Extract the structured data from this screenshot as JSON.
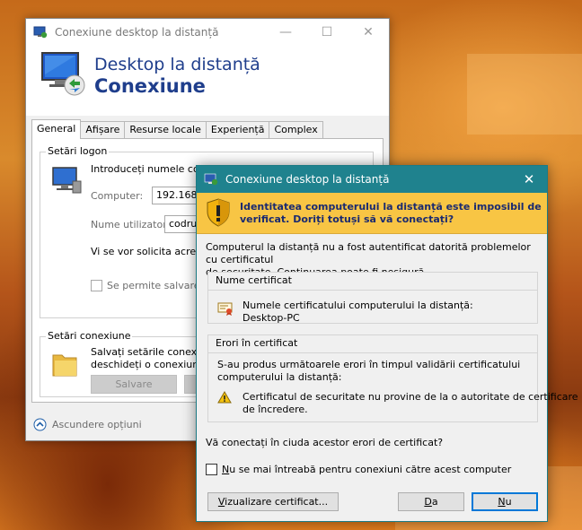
{
  "main_window": {
    "title": "Conexiune desktop la distanță",
    "header_line1": "Desktop la distanță",
    "header_line2": "Conexiune",
    "tabs": [
      {
        "label": "General"
      },
      {
        "label": "Afișare"
      },
      {
        "label": "Resurse locale"
      },
      {
        "label": "Experiență"
      },
      {
        "label": "Complex"
      }
    ],
    "logon": {
      "group_label": "Setări logon",
      "intro": "Introduceți numele computerului la distanță.",
      "computer_label": "Computer:",
      "computer_value": "192.168.",
      "user_label": "Nume utilizator:",
      "user_value": "codru",
      "credentials_note": "Vi se vor solicita acreditările la conectare.",
      "save_checkbox_label": "Se permite salvarea acreditărilor"
    },
    "connection": {
      "group_label": "Setări conexiune",
      "line1": "Salvați setările conexiunii curente într-un",
      "line2": "deschideți o conexiune salvată.",
      "save_button": "Salvare"
    },
    "hide_options": "Ascundere opțiuni"
  },
  "security_dialog": {
    "title": "Conexiune desktop la distanță",
    "warning_title_line1": "Identitatea computerului la distanță este imposibil de",
    "warning_title_line2": "verificat. Doriți totuși să vă conectați?",
    "description_line1": "Computerul la distanță nu a fost autentificat datorită problemelor cu certificatul",
    "description_line2": "de securitate. Continuarea poate fi nesigură.",
    "certificate_group_label": "Nume certificat",
    "certificate_name_label": "Numele certificatului computerului la distanță:",
    "certificate_name_value": "Desktop-PC",
    "errors_group_label": "Erori în certificat",
    "errors_intro_line1": "S-au produs următoarele erori în timpul validării certificatului",
    "errors_intro_line2": "computerului la distanță:",
    "error_line1": "Certificatul de securitate nu provine de la o autoritate de certificare",
    "error_line2": "de încredere.",
    "question": "Vă conectați în ciuda acestor erori de certificat?",
    "dont_ask_checkbox_prefix": "N",
    "dont_ask_checkbox_rest": "u se mai întreabă pentru conexiuni către acest computer",
    "view_cert_button_prefix": "V",
    "view_cert_button_rest": "izualizare certificat...",
    "yes_button_prefix": "D",
    "yes_button_rest": "a",
    "no_button_prefix": "N",
    "no_button_rest": "u"
  },
  "colors": {
    "dialog_titlebar": "#1f828e",
    "warning_banner": "#f8c544",
    "header_text": "#1f3e8c",
    "primary_border": "#0078d7"
  }
}
